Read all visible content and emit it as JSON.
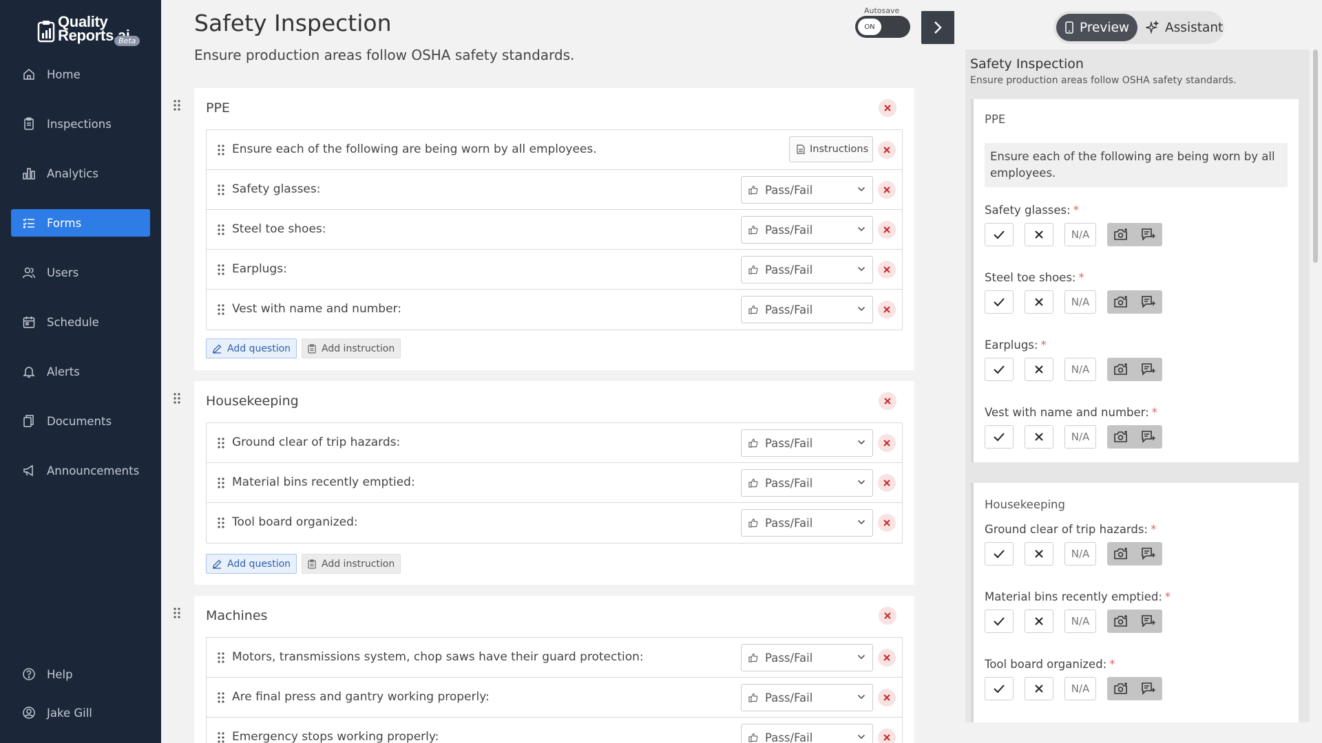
{
  "app": {
    "logo_line1": "Quality",
    "logo_line2": "Reports.ai",
    "logo_badge": "Beta",
    "brand_color": "#2e7ce6",
    "sidebar_color": "#1b2638"
  },
  "sidebar": {
    "items": [
      {
        "label": "Home",
        "icon": "home-icon"
      },
      {
        "label": "Inspections",
        "icon": "clipboard-icon"
      },
      {
        "label": "Analytics",
        "icon": "bar-chart-icon"
      },
      {
        "label": "Forms",
        "icon": "list-icon",
        "active": true
      },
      {
        "label": "Users",
        "icon": "users-icon"
      },
      {
        "label": "Schedule",
        "icon": "calendar-icon"
      },
      {
        "label": "Alerts",
        "icon": "bell-icon"
      },
      {
        "label": "Documents",
        "icon": "documents-icon"
      },
      {
        "label": "Announcements",
        "icon": "megaphone-icon"
      }
    ],
    "help": "Help",
    "user": "Jake Gill"
  },
  "editor": {
    "title": "Safety Inspection",
    "subtitle": "Ensure production areas follow OSHA safety standards.",
    "autosave_label": "Autosave",
    "autosave_state": "ON",
    "add_question_label": "Add question",
    "add_instruction_label": "Add instruction",
    "instructions_button": "Instructions",
    "type_label": "Pass/Fail",
    "sections": [
      {
        "title": "PPE",
        "instruction": "Ensure each of the following are being worn by all employees.",
        "questions": [
          "Safety glasses:",
          "Steel toe shoes:",
          "Earplugs:",
          "Vest with name and number:"
        ]
      },
      {
        "title": "Housekeeping",
        "questions": [
          "Ground clear of trip hazards:",
          "Material bins recently emptied:",
          "Tool board organized:"
        ]
      },
      {
        "title": "Machines",
        "questions": [
          "Motors, transmissions system, chop saws have their guard protection:",
          "Are final press and gantry working properly:",
          "Emergency stops working properly:"
        ]
      }
    ]
  },
  "panel": {
    "tabs": [
      {
        "label": "Preview",
        "icon": "phone-icon",
        "active": true
      },
      {
        "label": "Assistant",
        "icon": "sparkle-icon"
      }
    ],
    "preview": {
      "title": "Safety Inspection",
      "subtitle": "Ensure production areas follow OSHA safety standards.",
      "na_label": "N/A",
      "required_mark": "*",
      "sections": [
        {
          "title": "PPE",
          "instruction": "Ensure each of the following are being worn by all employees.",
          "questions": [
            "Safety glasses:",
            "Steel toe shoes:",
            "Earplugs:",
            "Vest with name and number:"
          ]
        },
        {
          "title": "Housekeeping",
          "questions": [
            "Ground clear of trip hazards:",
            "Material bins recently emptied:",
            "Tool board organized:"
          ]
        }
      ]
    }
  }
}
